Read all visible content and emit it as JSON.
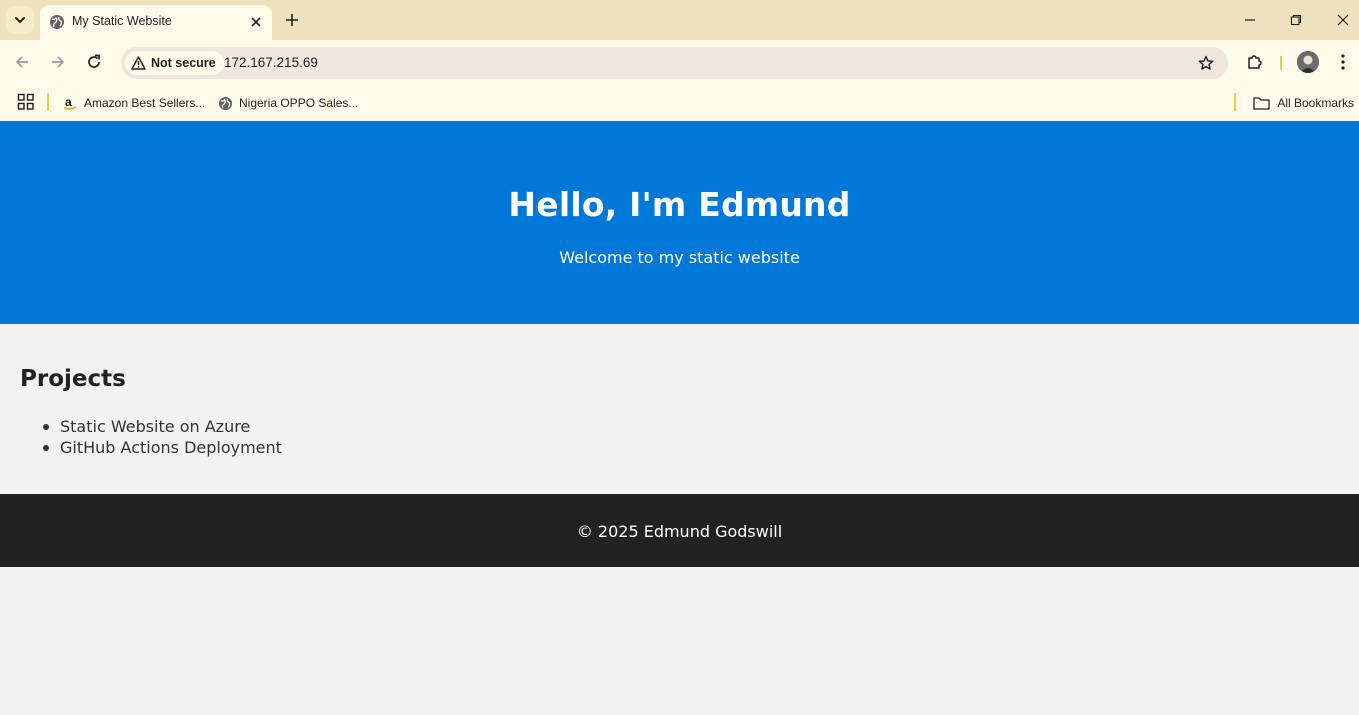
{
  "browser": {
    "tab": {
      "title": "My Static Website",
      "favicon": "globe-icon"
    },
    "address_bar": {
      "security_label": "Not secure",
      "url": "172.167.215.69"
    },
    "bookmarks": [
      {
        "label": "Amazon Best Sellers...",
        "icon": "amazon-icon"
      },
      {
        "label": "Nigeria OPPO Sales...",
        "icon": "globe-icon"
      }
    ],
    "all_bookmarks_label": "All Bookmarks",
    "colors": {
      "tab_strip": "#ede2bd",
      "toolbar": "#fffbea",
      "omnibox": "#efe6de"
    }
  },
  "page": {
    "hero": {
      "title": "Hello, I'm Edmund",
      "subtitle": "Welcome to my static website"
    },
    "projects": {
      "heading": "Projects",
      "items": [
        "Static Website on Azure",
        "GitHub Actions Deployment"
      ]
    },
    "footer": {
      "text": "© 2025 Edmund Godswill"
    },
    "colors": {
      "hero_bg": "#0078d7",
      "footer_bg": "#222222",
      "page_bg": "#f2f2f2"
    }
  }
}
